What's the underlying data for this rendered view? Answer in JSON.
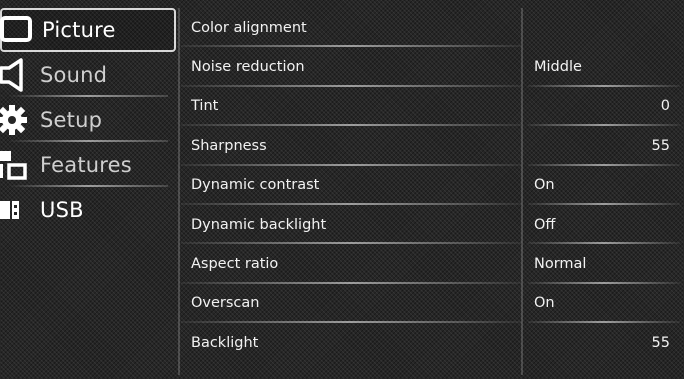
{
  "left_menu": {
    "items": [
      {
        "label": "Picture",
        "icon": "picture-icon",
        "selected": true
      },
      {
        "label": "Sound",
        "icon": "speaker-icon",
        "selected": false
      },
      {
        "label": "Setup",
        "icon": "gear-icon",
        "selected": false
      },
      {
        "label": "Features",
        "icon": "features-icon",
        "selected": false
      },
      {
        "label": "USB",
        "icon": "usb-icon",
        "selected": false
      }
    ]
  },
  "settings": {
    "rows": [
      {
        "label": "Color alignment",
        "value": "",
        "align": "left"
      },
      {
        "label": "Noise reduction",
        "value": "Middle",
        "align": "left"
      },
      {
        "label": "Tint",
        "value": "0",
        "align": "right"
      },
      {
        "label": "Sharpness",
        "value": "55",
        "align": "right"
      },
      {
        "label": "Dynamic contrast",
        "value": "On",
        "align": "left"
      },
      {
        "label": "Dynamic backlight",
        "value": "Off",
        "align": "left"
      },
      {
        "label": "Aspect ratio",
        "value": "Normal",
        "align": "left"
      },
      {
        "label": "Overscan",
        "value": "On",
        "align": "left"
      },
      {
        "label": "Backlight",
        "value": "55",
        "align": "right"
      }
    ]
  },
  "colors": {
    "background": "#262626",
    "text": "#f2f2f2",
    "selection_border": "#d8d8d8"
  }
}
